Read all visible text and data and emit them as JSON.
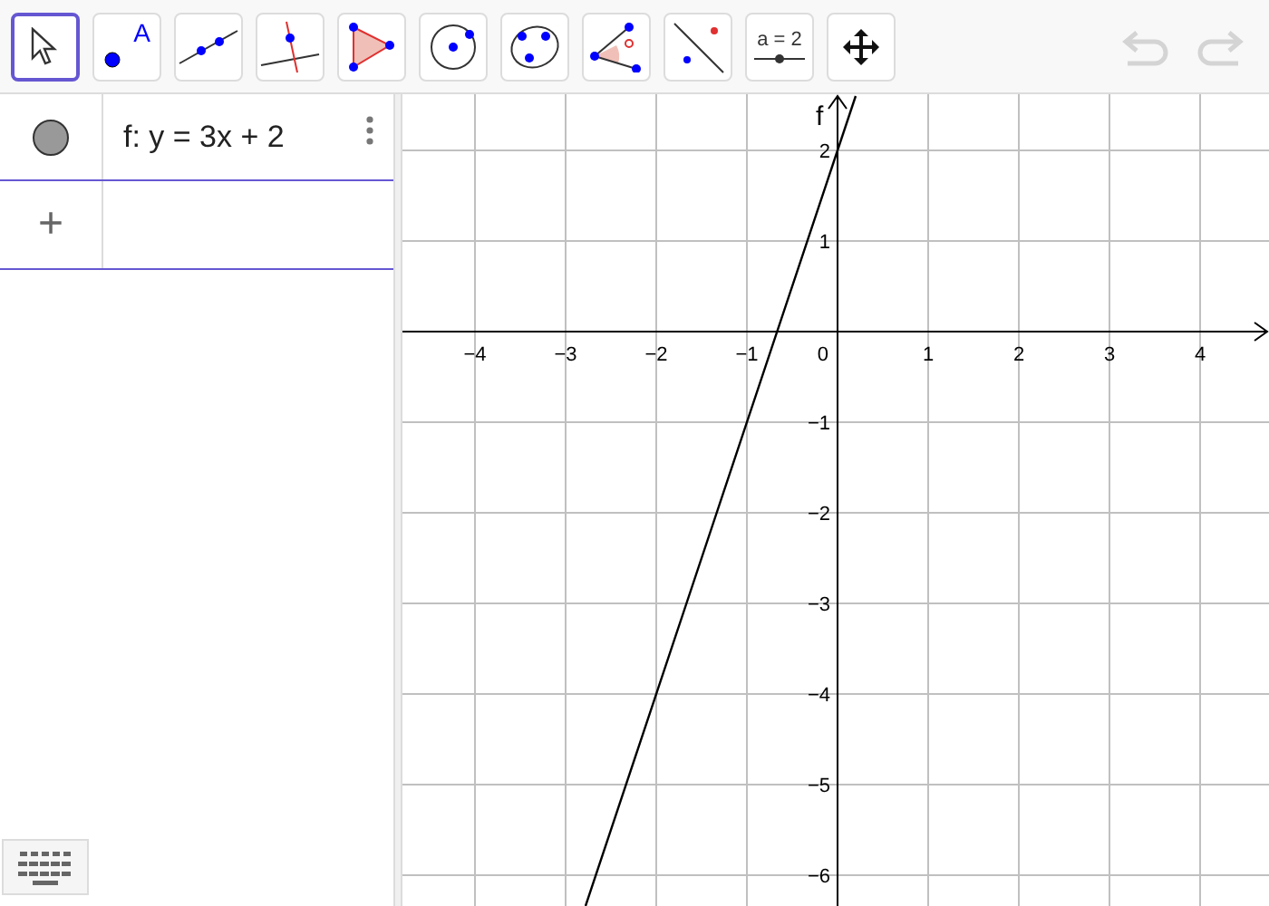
{
  "toolbar": {
    "tools": [
      {
        "kind": "move",
        "selected": true
      },
      {
        "kind": "point",
        "label": "A",
        "selected": false
      },
      {
        "kind": "line",
        "selected": false
      },
      {
        "kind": "perpendicular",
        "selected": false
      },
      {
        "kind": "polygon",
        "selected": false
      },
      {
        "kind": "circle",
        "selected": false
      },
      {
        "kind": "conic",
        "selected": false
      },
      {
        "kind": "angle",
        "selected": false
      },
      {
        "kind": "reflect",
        "selected": false
      },
      {
        "kind": "slider",
        "label": "a = 2",
        "selected": false
      },
      {
        "kind": "pan",
        "selected": false
      }
    ],
    "undo": {
      "disabled": true
    },
    "redo": {
      "disabled": true
    }
  },
  "algebra": {
    "items": [
      {
        "text": "f: y = 3x + 2",
        "visible": true
      }
    ],
    "input": {
      "icon": "+"
    }
  },
  "graphics": {
    "origin_label": "0",
    "chart_data": {
      "type": "line",
      "grid": true,
      "x": [
        -2.78,
        0.2
      ],
      "series": [
        {
          "name": "f",
          "color": "#000000",
          "values": [
            -6.34,
            2.6
          ]
        }
      ],
      "xlim": [
        -4.8,
        4.76
      ],
      "ylim": [
        -6.34,
        2.62
      ],
      "xticks": [
        {
          "value": -4,
          "label": "−4"
        },
        {
          "value": -3,
          "label": "−3"
        },
        {
          "value": -2,
          "label": "−2"
        },
        {
          "value": -1,
          "label": "−1"
        },
        {
          "value": 1,
          "label": "1"
        },
        {
          "value": 2,
          "label": "2"
        },
        {
          "value": 3,
          "label": "3"
        },
        {
          "value": 4,
          "label": "4"
        }
      ],
      "yticks": [
        {
          "value": -6,
          "label": "−6"
        },
        {
          "value": -5,
          "label": "−5"
        },
        {
          "value": -4,
          "label": "−4"
        },
        {
          "value": -3,
          "label": "−3"
        },
        {
          "value": -2,
          "label": "−2"
        },
        {
          "value": -1,
          "label": "−1"
        },
        {
          "value": 1,
          "label": "1"
        },
        {
          "value": 2,
          "label": "2"
        }
      ]
    }
  }
}
